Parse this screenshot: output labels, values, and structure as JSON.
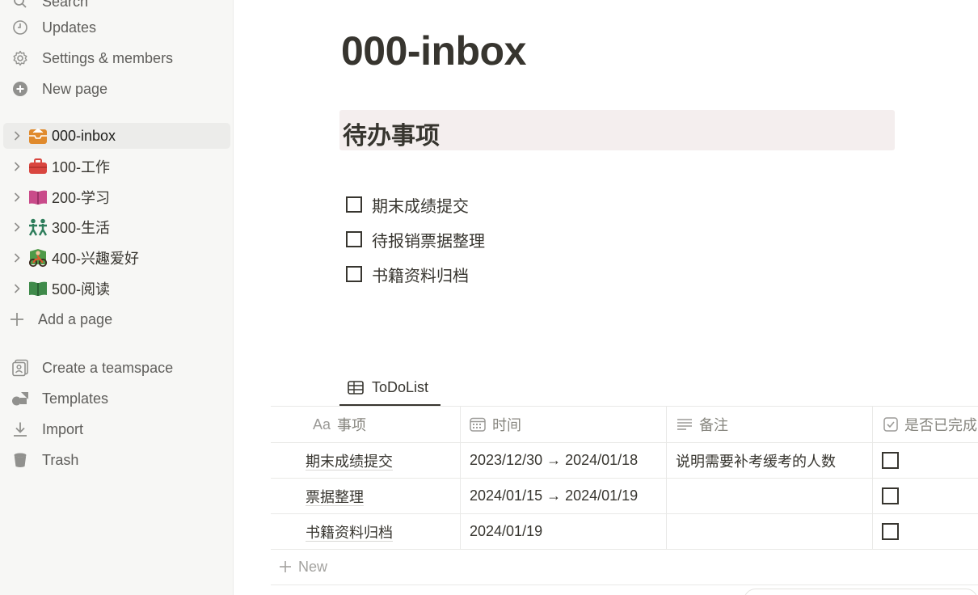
{
  "sidebar": {
    "search_label": "Search",
    "updates_label": "Updates",
    "settings_label": "Settings & members",
    "newpage_label": "New page",
    "pages": [
      {
        "label": "000-inbox",
        "icon": "inbox-icon"
      },
      {
        "label": "100-工作",
        "icon": "briefcase-icon"
      },
      {
        "label": "200-学习",
        "icon": "open-book-icon"
      },
      {
        "label": "300-生活",
        "icon": "people-icon"
      },
      {
        "label": "400-兴趣爱好",
        "icon": "cyclist-icon"
      },
      {
        "label": "500-阅读",
        "icon": "green-book-icon"
      }
    ],
    "add_page_label": "Add a page",
    "create_teamspace_label": "Create a teamspace",
    "templates_label": "Templates",
    "import_label": "Import",
    "trash_label": "Trash"
  },
  "page": {
    "title": "000-inbox",
    "callout_heading": "待办事项",
    "todos": [
      {
        "text": "期末成绩提交",
        "checked": false
      },
      {
        "text": "待报销票据整理",
        "checked": false
      },
      {
        "text": "书籍资料归档",
        "checked": false
      }
    ]
  },
  "database": {
    "tab_label": "ToDoList",
    "columns": [
      {
        "label": "事项",
        "icon": "Aa"
      },
      {
        "label": "时间",
        "icon": "calendar-icon"
      },
      {
        "label": "备注",
        "icon": "text-lines-icon"
      },
      {
        "label": "是否已完成",
        "icon": "checkbox-icon"
      }
    ],
    "rows": [
      {
        "name": "期末成绩提交",
        "date": "2023/12/30 → 2024/01/18",
        "note": "说明需要补考缓考的人数",
        "done": false
      },
      {
        "name": "票据整理",
        "date": "2024/01/15 → 2024/01/19",
        "note": "",
        "done": false
      },
      {
        "name": "书籍资料归档",
        "date": "2024/01/19",
        "note": "",
        "done": false
      }
    ],
    "new_label": "New"
  },
  "colors": {
    "sidebar_bg": "#f7f7f5",
    "callout_bg": "#f4eeee",
    "text": "#37352f",
    "muted": "#91918e"
  }
}
